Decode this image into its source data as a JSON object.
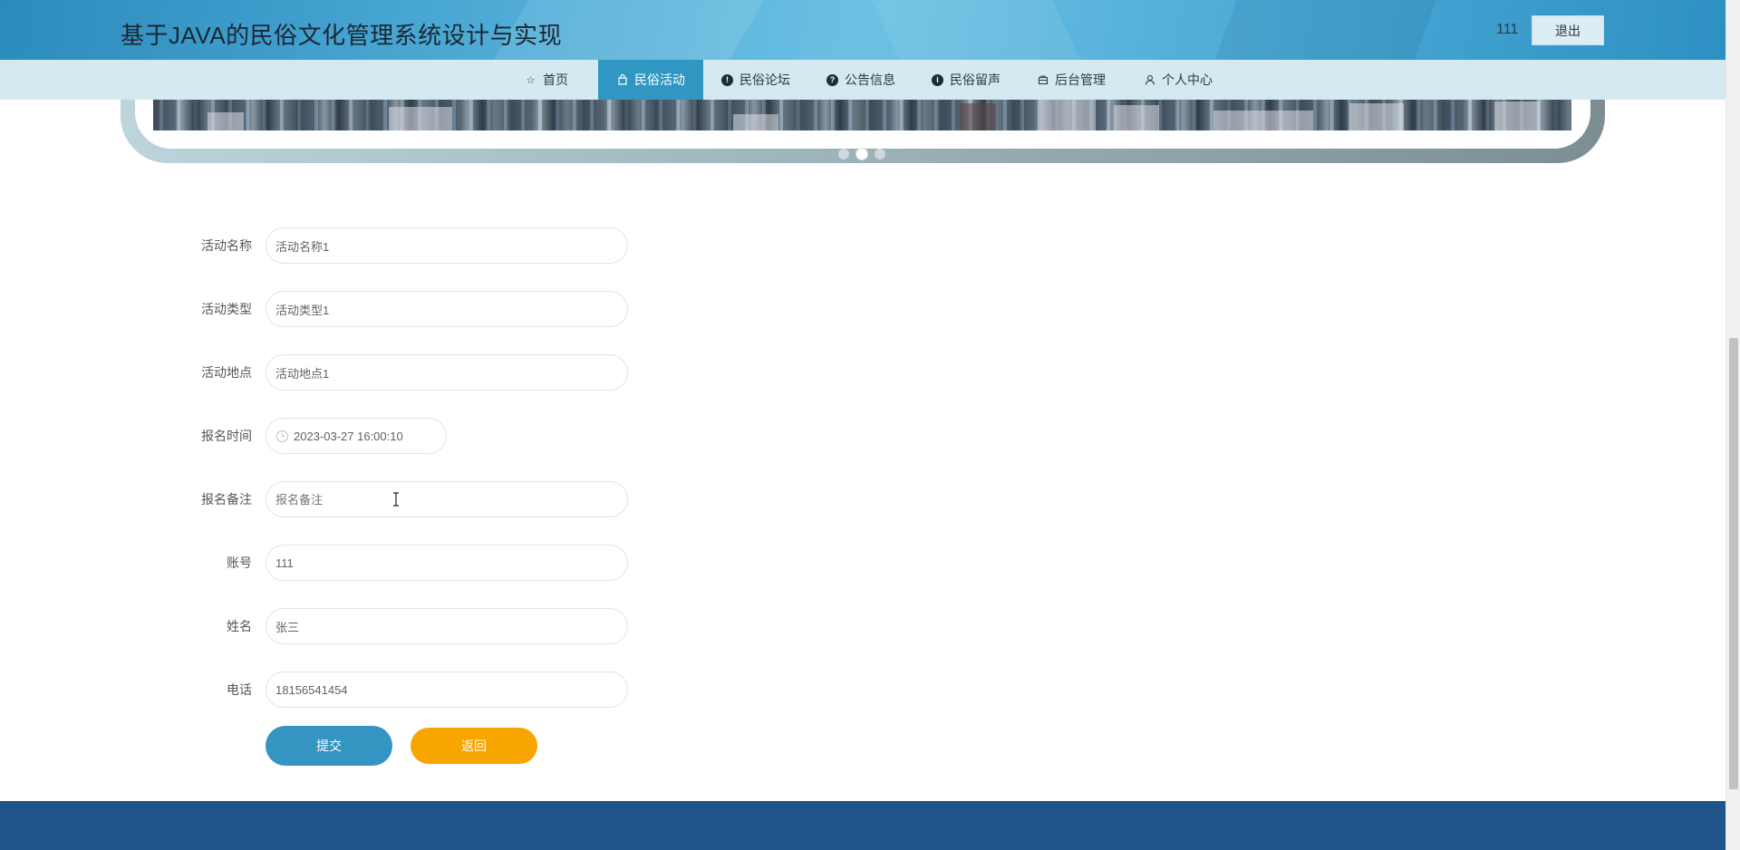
{
  "header": {
    "title": "基于JAVA的民俗文化管理系统设计与实现",
    "username": "111",
    "logout_label": "退出"
  },
  "nav": {
    "items": [
      {
        "label": "首页",
        "icon": "star-icon",
        "active": false
      },
      {
        "label": "民俗活动",
        "icon": "bag-icon",
        "active": true
      },
      {
        "label": "民俗论坛",
        "icon": "exclamation-circle-icon",
        "active": false
      },
      {
        "label": "公告信息",
        "icon": "question-circle-icon",
        "active": false
      },
      {
        "label": "民俗留声",
        "icon": "info-circle-icon",
        "active": false
      },
      {
        "label": "后台管理",
        "icon": "briefcase-icon",
        "active": false
      },
      {
        "label": "个人中心",
        "icon": "user-icon",
        "active": false
      }
    ]
  },
  "carousel": {
    "active_index": 1,
    "count": 3
  },
  "form": {
    "fields": [
      {
        "label": "活动名称",
        "value": "活动名称1",
        "placeholder": ""
      },
      {
        "label": "活动类型",
        "value": "活动类型1",
        "placeholder": ""
      },
      {
        "label": "活动地点",
        "value": "活动地点1",
        "placeholder": ""
      },
      {
        "label": "报名时间",
        "value": "2023-03-27 16:00:10",
        "placeholder": ""
      },
      {
        "label": "报名备注",
        "value": "",
        "placeholder": "报名备注"
      },
      {
        "label": "账号",
        "value": "111",
        "placeholder": ""
      },
      {
        "label": "姓名",
        "value": "张三",
        "placeholder": ""
      },
      {
        "label": "电话",
        "value": "18156541454",
        "placeholder": ""
      }
    ],
    "submit_label": "提交",
    "back_label": "返回"
  },
  "colors": {
    "accent": "#2f97c1",
    "submit": "#3495c2",
    "back": "#f9a500",
    "footer": "#1e5588"
  }
}
